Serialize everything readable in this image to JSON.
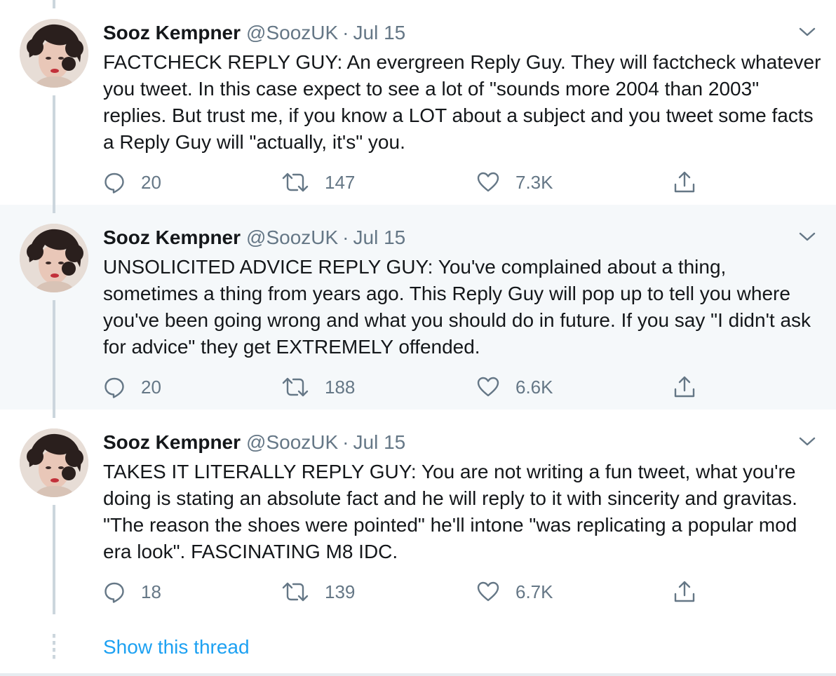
{
  "tweets": [
    {
      "author_name": "Sooz Kempner",
      "handle": "@SoozUK",
      "separator": "·",
      "date": "Jul 15",
      "text": "FACTCHECK REPLY GUY: An evergreen Reply Guy. They will factcheck whatever you tweet. In this case expect to see a lot of \"sounds more 2004 than 2003\" replies. But trust me, if you know a LOT about a subject and you tweet some facts a Reply Guy will \"actually, it's\" you.",
      "replies": "20",
      "retweets": "147",
      "likes": "7.3K"
    },
    {
      "author_name": "Sooz Kempner",
      "handle": "@SoozUK",
      "separator": "·",
      "date": "Jul 15",
      "text": "UNSOLICITED ADVICE REPLY GUY: You've complained about a thing, sometimes a thing from years ago. This Reply Guy will pop up to tell you where you've been going wrong and what you should do in future. If you say \"I didn't ask for advice\" they get EXTREMELY offended.",
      "replies": "20",
      "retweets": "188",
      "likes": "6.6K"
    },
    {
      "author_name": "Sooz Kempner",
      "handle": "@SoozUK",
      "separator": "·",
      "date": "Jul 15",
      "text": "TAKES IT LITERALLY REPLY GUY: You are not writing a fun tweet, what you're doing is stating an absolute fact and he will reply to it with sincerity and gravitas. \"The reason the shoes were pointed\" he'll intone \"was replicating a popular mod era look\". FASCINATING M8 IDC.",
      "replies": "18",
      "retweets": "139",
      "likes": "6.7K"
    }
  ],
  "show_thread_label": "Show this thread",
  "icons": {
    "reply": "speech-bubble-icon",
    "retweet": "retweet-arrows-icon",
    "like": "heart-outline-icon",
    "share": "share-upload-icon",
    "more": "chevron-down-icon"
  },
  "colors": {
    "link": "#1da1f2",
    "secondary_text": "#657786",
    "primary_text": "#14171a",
    "highlight_bg": "#f5f8fa",
    "thread_line": "#ccd6dd"
  }
}
